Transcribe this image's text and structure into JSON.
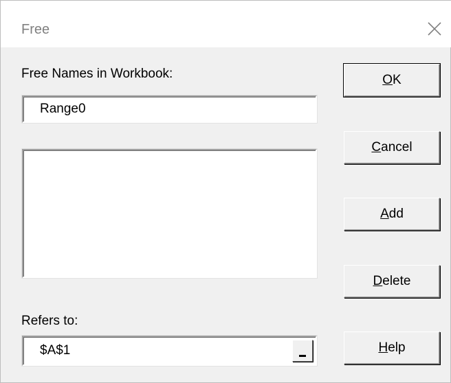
{
  "window": {
    "title": "Free"
  },
  "form": {
    "names_label": "Free Names in Workbook:",
    "name_value": "Range0",
    "names_list": [],
    "refers_label": "Refers to:",
    "refers_value": "$A$1"
  },
  "buttons": {
    "ok": {
      "mnemonic": "O",
      "rest": "K"
    },
    "cancel": {
      "mnemonic": "C",
      "rest": "ancel"
    },
    "add": {
      "mnemonic": "A",
      "rest": "dd"
    },
    "delete": {
      "mnemonic": "D",
      "rest": "elete"
    },
    "help": {
      "mnemonic": "H",
      "rest": "elp"
    }
  },
  "icons": {
    "close": "close-icon",
    "collapse": "collapse-dialog-icon"
  },
  "colors": {
    "dialog_bg": "#f0f0f0",
    "titlebar_bg": "#ffffff",
    "title_text": "#808080"
  }
}
